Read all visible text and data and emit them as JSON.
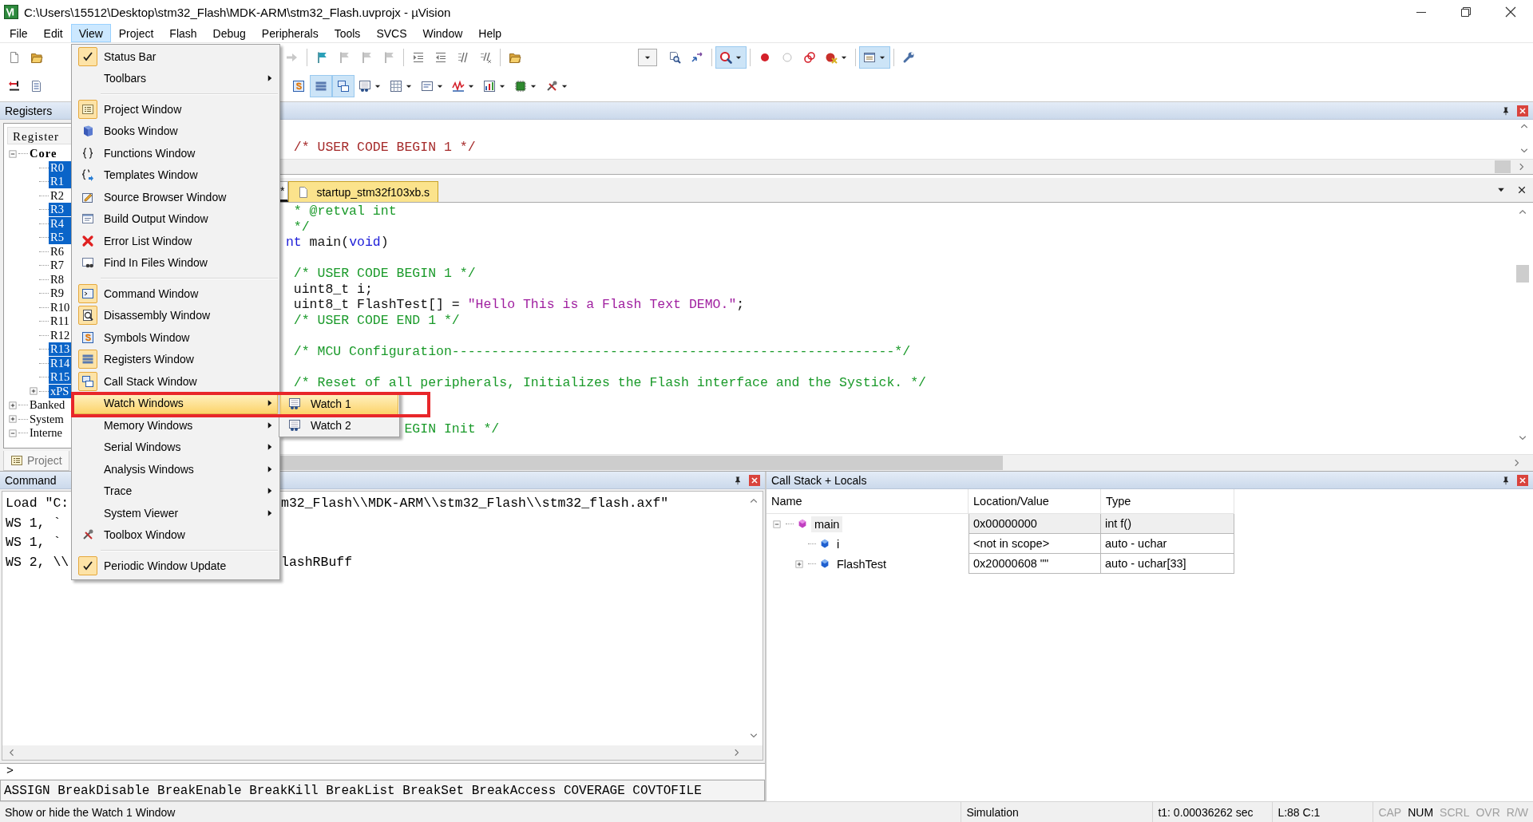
{
  "window": {
    "title": "C:\\Users\\15512\\Desktop\\stm32_Flash\\MDK-ARM\\stm32_Flash.uvprojx - µVision"
  },
  "menu_bar": [
    {
      "label": "File",
      "selected": false
    },
    {
      "label": "Edit",
      "selected": false
    },
    {
      "label": "View",
      "selected": true
    },
    {
      "label": "Project",
      "selected": false
    },
    {
      "label": "Flash",
      "selected": false
    },
    {
      "label": "Debug",
      "selected": false
    },
    {
      "label": "Peripherals",
      "selected": false
    },
    {
      "label": "Tools",
      "selected": false
    },
    {
      "label": "SVCS",
      "selected": false
    },
    {
      "label": "Window",
      "selected": false
    },
    {
      "label": "Help",
      "selected": false
    }
  ],
  "toolbars": [
    {
      "buttons": [
        {
          "pressed": false
        },
        {
          "pressed": false
        },
        {
          "pressed": false
        },
        {
          "pressed": false
        },
        {
          "pressed": false
        },
        {
          "pressed": false
        },
        {
          "pressed": false
        },
        {
          "pressed": false
        },
        {
          "pressed": false
        },
        {
          "pressed": false
        },
        {
          "pressed": false
        },
        {
          "pressed": false
        },
        {
          "pressed": false
        },
        {
          "pressed": false
        },
        {
          "pressed": true
        },
        {
          "pressed": false
        },
        {
          "pressed": false
        },
        {
          "pressed": false
        },
        {
          "pressed": false
        },
        {
          "pressed": true
        },
        {
          "pressed": false
        }
      ]
    },
    {
      "buttons": [
        {
          "pressed": false
        },
        {
          "pressed": false
        },
        {
          "pressed": false
        },
        {
          "pressed": true
        },
        {
          "pressed": true
        },
        {
          "pressed": false
        },
        {
          "pressed": false
        },
        {
          "pressed": false
        },
        {
          "pressed": false
        },
        {
          "pressed": false
        },
        {
          "pressed": false
        },
        {
          "pressed": false
        }
      ]
    }
  ],
  "registers_panel": {
    "title": "Registers",
    "column": "Register",
    "tree": [
      {
        "label": "Core",
        "expanded": true,
        "children": [
          {
            "label": "R0",
            "changed": true
          },
          {
            "label": "R1",
            "changed": true
          },
          {
            "label": "R2",
            "changed": false
          },
          {
            "label": "R3",
            "changed": true
          },
          {
            "label": "R4",
            "changed": true
          },
          {
            "label": "R5",
            "changed": true
          },
          {
            "label": "R6",
            "changed": false
          },
          {
            "label": "R7",
            "changed": false
          },
          {
            "label": "R8",
            "changed": false
          },
          {
            "label": "R9",
            "changed": false
          },
          {
            "label": "R10",
            "changed": false
          },
          {
            "label": "R11",
            "changed": false
          },
          {
            "label": "R12",
            "changed": false
          },
          {
            "label": "R13",
            "changed": true
          },
          {
            "label": "R14",
            "changed": true
          },
          {
            "label": "R15",
            "changed": true
          },
          {
            "label": "xPS",
            "changed": true,
            "expanded": false
          }
        ]
      },
      {
        "label": "Banked",
        "expanded": false
      },
      {
        "label": "System",
        "expanded": false
      },
      {
        "label": "Interne",
        "expanded": true
      }
    ],
    "tab": "Project"
  },
  "disassembly_pane": {
    "lines": [
      "/* USER CODE BEGIN 1 */"
    ]
  },
  "editor": {
    "tabs": [
      {
        "label": "*",
        "selected": true
      },
      {
        "label": "startup_stm32f103xb.s",
        "selected": false
      }
    ],
    "lines": [
      {
        "kind": "code",
        "segments": [
          {
            "kind": "comment",
            "text": "  * @retval int"
          }
        ]
      },
      {
        "kind": "code",
        "segments": [
          {
            "kind": "comment",
            "text": "  */"
          }
        ]
      },
      {
        "kind": "code",
        "segments": [
          {
            "kind": "keyword",
            "text": " nt"
          },
          {
            "kind": "plain",
            "text": " main("
          },
          {
            "kind": "keyword",
            "text": "void"
          },
          {
            "kind": "plain",
            "text": ")"
          }
        ]
      },
      {
        "kind": "blank"
      },
      {
        "kind": "code",
        "segments": [
          {
            "kind": "comment",
            "text": "  /* USER CODE BEGIN 1 */"
          }
        ]
      },
      {
        "kind": "code",
        "segments": [
          {
            "kind": "plain",
            "text": "  uint8_t i;"
          }
        ]
      },
      {
        "kind": "code",
        "segments": [
          {
            "kind": "plain",
            "text": "  uint8_t FlashTest[] = "
          },
          {
            "kind": "string",
            "text": "\"Hello This is a Flash Text DEMO.\""
          },
          {
            "kind": "plain",
            "text": ";"
          }
        ]
      },
      {
        "kind": "code",
        "segments": [
          {
            "kind": "comment",
            "text": "  /* USER CODE END 1 */"
          }
        ]
      },
      {
        "kind": "blank"
      },
      {
        "kind": "code",
        "segments": [
          {
            "kind": "comment",
            "text": "  /* MCU Configuration--------------------------------------------------------*/"
          }
        ]
      },
      {
        "kind": "blank"
      },
      {
        "kind": "code",
        "segments": [
          {
            "kind": "comment",
            "text": "  /* Reset of all peripherals, Initializes the Flash interface and the Systick. */"
          }
        ]
      },
      {
        "kind": "blank"
      },
      {
        "kind": "blank"
      },
      {
        "kind": "code",
        "segments": [
          {
            "kind": "comment",
            "text": "                EGIN Init */"
          }
        ]
      }
    ]
  },
  "view_menu": {
    "items": [
      {
        "kind": "check",
        "label": "Status Bar",
        "checked": true,
        "selected": false
      },
      {
        "kind": "submenu",
        "label": "Toolbars",
        "selected": false
      },
      {
        "kind": "separator"
      },
      {
        "kind": "item",
        "label": "Project Window",
        "checked": true,
        "selected": false
      },
      {
        "kind": "item",
        "label": "Books Window",
        "checked": false,
        "selected": false
      },
      {
        "kind": "item",
        "label": "Functions Window",
        "checked": false,
        "selected": false
      },
      {
        "kind": "item",
        "label": "Templates Window",
        "checked": false,
        "selected": false
      },
      {
        "kind": "item",
        "label": "Source Browser Window",
        "checked": false,
        "selected": false
      },
      {
        "kind": "item",
        "label": "Build Output Window",
        "checked": false,
        "selected": false
      },
      {
        "kind": "item",
        "label": "Error List Window",
        "checked": false,
        "selected": false
      },
      {
        "kind": "item",
        "label": "Find In Files Window",
        "checked": false,
        "selected": false
      },
      {
        "kind": "separator"
      },
      {
        "kind": "item",
        "label": "Command Window",
        "checked": true,
        "selected": false
      },
      {
        "kind": "item",
        "label": "Disassembly Window",
        "checked": true,
        "selected": false
      },
      {
        "kind": "item",
        "label": "Symbols Window",
        "checked": false,
        "selected": false
      },
      {
        "kind": "item",
        "label": "Registers Window",
        "checked": true,
        "selected": false
      },
      {
        "kind": "item",
        "label": "Call Stack Window",
        "checked": true,
        "selected": false
      },
      {
        "kind": "submenu",
        "label": "Watch Windows",
        "selected": true
      },
      {
        "kind": "submenu",
        "label": "Memory Windows",
        "selected": false
      },
      {
        "kind": "submenu",
        "label": "Serial Windows",
        "selected": false
      },
      {
        "kind": "submenu",
        "label": "Analysis Windows",
        "selected": false
      },
      {
        "kind": "submenu",
        "label": "Trace",
        "selected": false
      },
      {
        "kind": "submenu",
        "label": "System Viewer",
        "selected": false
      },
      {
        "kind": "item",
        "label": "Toolbox Window",
        "checked": false,
        "selected": false
      },
      {
        "kind": "separator"
      },
      {
        "kind": "check",
        "label": "Periodic Window Update",
        "checked": true,
        "selected": false
      }
    ],
    "submenu": [
      {
        "label": "Watch 1",
        "selected": true
      },
      {
        "label": "Watch 2",
        "selected": false
      }
    ]
  },
  "command_panel": {
    "title": "Command",
    "lines": [
      {
        "left": "Load \"C:",
        "right": "m32_Flash\\\\MDK-ARM\\\\stm32_Flash\\\\stm32_flash.axf\""
      },
      {
        "left": "WS 1, `"
      },
      {
        "left": "WS 1, `"
      },
      {
        "left": "WS 2, \\\\",
        "right": "lashRBuff"
      }
    ],
    "prompt": ">",
    "hint": "ASSIGN BreakDisable BreakEnable BreakKill BreakList BreakSet BreakAccess COVERAGE COVTOFILE"
  },
  "call_stack": {
    "title": "Call Stack + Locals",
    "columns": [
      "Name",
      "Location/Value",
      "Type"
    ],
    "rows": [
      {
        "name": "main",
        "value": "0x00000000",
        "type": "int f()",
        "expanded": true,
        "selected": true,
        "children": [
          {
            "name": "i",
            "value": "<not in scope>",
            "type": "auto - uchar",
            "selected": false
          },
          {
            "name": "FlashTest",
            "value": "0x20000608 \"\"",
            "type": "auto - uchar[33]",
            "expanded": false,
            "selected": false
          }
        ]
      }
    ]
  },
  "status_bar": {
    "message": "Show or hide the Watch 1 Window",
    "mode": "Simulation",
    "time": "t1: 0.00036262 sec",
    "position": "L:88 C:1",
    "indicators": [
      {
        "label": "CAP",
        "on": false
      },
      {
        "label": "NUM",
        "on": true
      },
      {
        "label": "SCRL",
        "on": false
      },
      {
        "label": "OVR",
        "on": false
      },
      {
        "label": "R/W",
        "on": false
      }
    ]
  }
}
